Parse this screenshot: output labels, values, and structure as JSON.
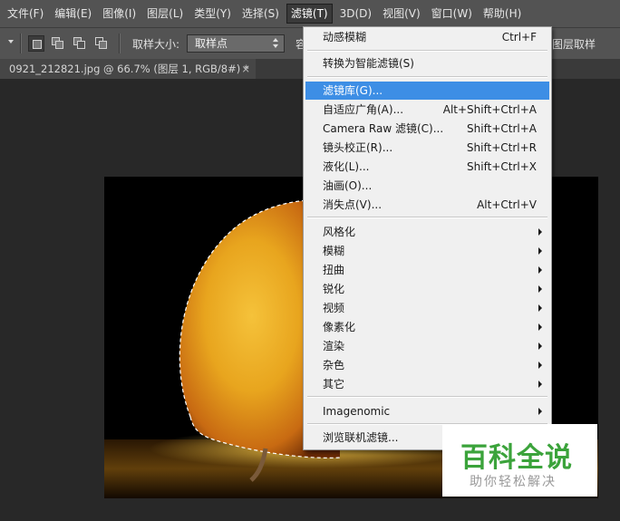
{
  "menubar": {
    "items": [
      {
        "label": "文件(F)"
      },
      {
        "label": "编辑(E)"
      },
      {
        "label": "图像(I)"
      },
      {
        "label": "图层(L)"
      },
      {
        "label": "类型(Y)"
      },
      {
        "label": "选择(S)"
      },
      {
        "label": "滤镜(T)",
        "active": true
      },
      {
        "label": "3D(D)"
      },
      {
        "label": "视图(V)"
      },
      {
        "label": "窗口(W)"
      },
      {
        "label": "帮助(H)"
      }
    ]
  },
  "options": {
    "sample_size_label": "取样大小:",
    "sample_size_value": "取样点",
    "tolerance_label_partial": "容",
    "sample_all_layers_partial": "图层取样"
  },
  "document": {
    "tab_title": "0921_212821.jpg @ 66.7% (图层 1, RGB/8#) *",
    "close_glyph": "×"
  },
  "filter_menu": {
    "items": [
      {
        "label": "动感模糊",
        "shortcut": "Ctrl+F"
      },
      {
        "label": "转换为智能滤镜(S)",
        "shortcut": ""
      },
      {
        "label": "滤镜库(G)...",
        "shortcut": "",
        "highlighted": true
      },
      {
        "label": "自适应广角(A)...",
        "shortcut": "Alt+Shift+Ctrl+A"
      },
      {
        "label": "Camera Raw 滤镜(C)...",
        "shortcut": "Shift+Ctrl+A"
      },
      {
        "label": "镜头校正(R)...",
        "shortcut": "Shift+Ctrl+R"
      },
      {
        "label": "液化(L)...",
        "shortcut": "Shift+Ctrl+X"
      },
      {
        "label": "油画(O)...",
        "shortcut": ""
      },
      {
        "label": "消失点(V)...",
        "shortcut": "Alt+Ctrl+V"
      },
      {
        "label": "风格化",
        "submenu": true
      },
      {
        "label": "模糊",
        "submenu": true
      },
      {
        "label": "扭曲",
        "submenu": true
      },
      {
        "label": "锐化",
        "submenu": true
      },
      {
        "label": "视频",
        "submenu": true
      },
      {
        "label": "像素化",
        "submenu": true
      },
      {
        "label": "渲染",
        "submenu": true
      },
      {
        "label": "杂色",
        "submenu": true
      },
      {
        "label": "其它",
        "submenu": true
      },
      {
        "label": "Imagenomic",
        "submenu": true
      },
      {
        "label": "浏览联机滤镜...",
        "shortcut": ""
      }
    ]
  },
  "watermark": {
    "title": "百科全说",
    "subtitle": "助你轻松解决"
  },
  "colors": {
    "menu_highlight": "#3d8ee5",
    "watermark_green": "#3ba33b",
    "ui_dark": "#535353",
    "workspace": "#282828"
  }
}
